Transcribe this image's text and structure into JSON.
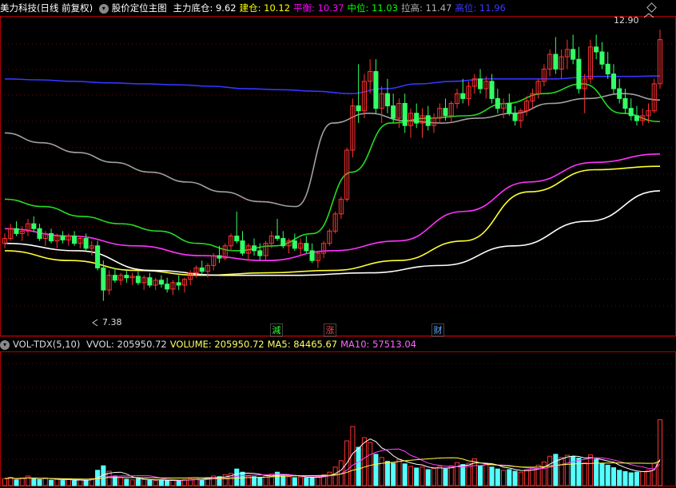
{
  "main_header": {
    "stock_name": "美力科技(日线 前复权)",
    "indicator_name": "股价定位主图",
    "items": [
      {
        "label": "主力底仓:",
        "value": "9.62",
        "color": "#ffffff"
      },
      {
        "label": "建仓:",
        "value": "10.12",
        "color": "#ffff00"
      },
      {
        "label": "平衡:",
        "value": "10.37",
        "color": "#ff00ff"
      },
      {
        "label": "中位:",
        "value": "11.03",
        "color": "#00ff00"
      },
      {
        "label": "拉高:",
        "value": "11.47",
        "color": "#b0b0b0"
      },
      {
        "label": "高位:",
        "value": "11.96",
        "color": "#3b3bff"
      }
    ]
  },
  "vol_header": {
    "indicator_name": "VOL-TDX(5,10)",
    "items": [
      {
        "label": "VVOL:",
        "value": "205950.72",
        "color": "#dddddd"
      },
      {
        "label": "VOLUME:",
        "value": "205950.72",
        "color": "#ffff66"
      },
      {
        "label": "MA5:",
        "value": "84465.67",
        "color": "#ffff66"
      },
      {
        "label": "MA10:",
        "value": "57513.04",
        "color": "#ff66ff"
      }
    ]
  },
  "annotations": {
    "high_label": "12.90",
    "low_label": "7.38"
  },
  "markers": [
    {
      "char": "減",
      "color": "#33ff33"
    },
    {
      "char": "涨",
      "color": "#ff4444"
    },
    {
      "char": "财",
      "color": "#66aaff"
    }
  ],
  "colors": {
    "up": "#ff3333",
    "down": "#33ff66",
    "vol_down": "#54ffff",
    "grid": "#7a0000",
    "border": "#b00000"
  },
  "chart_data": {
    "type": "candlestick",
    "price_range": [
      7.0,
      13.1
    ],
    "candles": [
      [
        8.55,
        8.75,
        8.45,
        8.65
      ],
      [
        8.65,
        8.95,
        8.6,
        8.85
      ],
      [
        8.85,
        9.0,
        8.7,
        8.75
      ],
      [
        8.75,
        8.9,
        8.6,
        8.8
      ],
      [
        8.8,
        9.05,
        8.7,
        8.95
      ],
      [
        8.95,
        9.1,
        8.8,
        8.85
      ],
      [
        8.85,
        8.95,
        8.6,
        8.65
      ],
      [
        8.65,
        8.8,
        8.5,
        8.75
      ],
      [
        8.75,
        8.85,
        8.55,
        8.6
      ],
      [
        8.6,
        8.75,
        8.45,
        8.7
      ],
      [
        8.7,
        8.8,
        8.55,
        8.62
      ],
      [
        8.62,
        8.75,
        8.5,
        8.7
      ],
      [
        8.7,
        8.8,
        8.5,
        8.55
      ],
      [
        8.55,
        8.7,
        8.45,
        8.65
      ],
      [
        8.65,
        8.75,
        8.4,
        8.45
      ],
      [
        8.45,
        8.6,
        8.3,
        8.5
      ],
      [
        8.5,
        8.6,
        8.0,
        8.05
      ],
      [
        8.05,
        8.2,
        7.38,
        7.6
      ],
      [
        7.6,
        8.0,
        7.5,
        7.9
      ],
      [
        7.9,
        8.05,
        7.75,
        7.8
      ],
      [
        7.8,
        7.95,
        7.7,
        7.9
      ],
      [
        7.9,
        8.0,
        7.75,
        7.85
      ],
      [
        7.85,
        7.95,
        7.7,
        7.88
      ],
      [
        7.88,
        7.98,
        7.7,
        7.75
      ],
      [
        7.75,
        7.9,
        7.6,
        7.85
      ],
      [
        7.85,
        7.95,
        7.65,
        7.7
      ],
      [
        7.7,
        7.85,
        7.6,
        7.8
      ],
      [
        7.8,
        7.9,
        7.65,
        7.72
      ],
      [
        7.72,
        7.85,
        7.55,
        7.62
      ],
      [
        7.62,
        7.8,
        7.5,
        7.75
      ],
      [
        7.75,
        7.9,
        7.6,
        7.7
      ],
      [
        7.7,
        7.85,
        7.55,
        7.82
      ],
      [
        7.82,
        8.0,
        7.7,
        7.95
      ],
      [
        7.95,
        8.1,
        7.85,
        8.05
      ],
      [
        8.05,
        8.2,
        7.9,
        7.98
      ],
      [
        7.98,
        8.15,
        7.85,
        8.1
      ],
      [
        8.1,
        8.35,
        8.0,
        8.3
      ],
      [
        8.3,
        8.5,
        8.15,
        8.25
      ],
      [
        8.25,
        8.55,
        8.2,
        8.5
      ],
      [
        8.5,
        8.75,
        8.4,
        8.7
      ],
      [
        8.7,
        9.2,
        8.55,
        8.6
      ],
      [
        8.6,
        8.8,
        8.3,
        8.35
      ],
      [
        8.35,
        8.55,
        8.2,
        8.5
      ],
      [
        8.5,
        8.65,
        8.3,
        8.4
      ],
      [
        8.4,
        8.55,
        8.2,
        8.3
      ],
      [
        8.3,
        8.6,
        8.2,
        8.55
      ],
      [
        8.55,
        8.8,
        8.45,
        8.7
      ],
      [
        8.7,
        9.05,
        8.6,
        8.65
      ],
      [
        8.65,
        8.8,
        8.45,
        8.5
      ],
      [
        8.5,
        8.65,
        8.35,
        8.6
      ],
      [
        8.6,
        8.75,
        8.4,
        8.45
      ],
      [
        8.45,
        8.65,
        8.3,
        8.55
      ],
      [
        8.55,
        8.7,
        8.35,
        8.4
      ],
      [
        8.4,
        8.55,
        8.15,
        8.2
      ],
      [
        8.2,
        8.4,
        8.05,
        8.35
      ],
      [
        8.35,
        8.6,
        8.25,
        8.55
      ],
      [
        8.55,
        8.85,
        8.5,
        8.8
      ],
      [
        8.8,
        9.2,
        8.75,
        9.15
      ],
      [
        9.15,
        9.5,
        9.05,
        9.45
      ],
      [
        9.45,
        10.5,
        9.4,
        10.45
      ],
      [
        10.45,
        11.5,
        10.3,
        11.35
      ],
      [
        11.35,
        12.2,
        11.0,
        11.25
      ],
      [
        11.25,
        12.0,
        11.1,
        11.85
      ],
      [
        11.85,
        12.3,
        11.6,
        12.05
      ],
      [
        12.05,
        12.3,
        11.2,
        11.3
      ],
      [
        11.3,
        11.75,
        11.0,
        11.6
      ],
      [
        11.6,
        11.9,
        11.2,
        11.35
      ],
      [
        11.35,
        11.6,
        11.0,
        11.1
      ],
      [
        11.1,
        11.5,
        10.9,
        11.4
      ],
      [
        11.4,
        11.6,
        10.8,
        10.95
      ],
      [
        10.95,
        11.3,
        10.7,
        11.2
      ],
      [
        11.2,
        11.4,
        10.9,
        11.0
      ],
      [
        11.0,
        11.3,
        10.7,
        11.15
      ],
      [
        11.15,
        11.35,
        10.85,
        10.95
      ],
      [
        10.95,
        11.2,
        10.8,
        11.1
      ],
      [
        11.1,
        11.4,
        11.0,
        11.3
      ],
      [
        11.3,
        11.5,
        11.05,
        11.15
      ],
      [
        11.15,
        11.45,
        11.0,
        11.4
      ],
      [
        11.4,
        11.7,
        11.3,
        11.6
      ],
      [
        11.6,
        11.9,
        11.4,
        11.5
      ],
      [
        11.5,
        11.85,
        11.35,
        11.75
      ],
      [
        11.75,
        12.0,
        11.6,
        11.9
      ],
      [
        11.9,
        12.1,
        11.6,
        11.7
      ],
      [
        11.7,
        11.95,
        11.5,
        11.85
      ],
      [
        11.85,
        12.0,
        11.4,
        11.5
      ],
      [
        11.5,
        11.7,
        11.2,
        11.3
      ],
      [
        11.3,
        11.5,
        11.1,
        11.4
      ],
      [
        11.4,
        11.6,
        11.15,
        11.2
      ],
      [
        11.2,
        11.35,
        10.95,
        11.05
      ],
      [
        11.05,
        11.3,
        10.9,
        11.25
      ],
      [
        11.25,
        11.55,
        11.15,
        11.45
      ],
      [
        11.45,
        11.7,
        11.3,
        11.6
      ],
      [
        11.6,
        11.9,
        11.5,
        11.85
      ],
      [
        11.85,
        12.2,
        11.75,
        12.1
      ],
      [
        12.1,
        12.5,
        11.95,
        12.4
      ],
      [
        12.4,
        12.75,
        12.0,
        12.1
      ],
      [
        12.1,
        12.5,
        11.9,
        12.35
      ],
      [
        12.35,
        12.7,
        12.1,
        12.5
      ],
      [
        12.5,
        12.8,
        12.2,
        12.3
      ],
      [
        12.3,
        12.55,
        11.6,
        11.7
      ],
      [
        11.7,
        12.0,
        11.2,
        11.9
      ],
      [
        11.9,
        12.7,
        11.8,
        12.55
      ],
      [
        12.55,
        12.8,
        12.3,
        12.45
      ],
      [
        12.45,
        12.65,
        12.1,
        12.2
      ],
      [
        12.2,
        12.45,
        11.9,
        12.0
      ],
      [
        12.0,
        12.2,
        11.6,
        11.7
      ],
      [
        11.7,
        11.9,
        11.4,
        11.5
      ],
      [
        11.5,
        11.7,
        11.2,
        11.3
      ],
      [
        11.3,
        11.5,
        11.05,
        11.15
      ],
      [
        11.15,
        11.35,
        10.95,
        11.05
      ],
      [
        11.05,
        11.3,
        10.95,
        11.15
      ],
      [
        11.15,
        11.4,
        11.0,
        11.25
      ],
      [
        11.25,
        11.9,
        11.2,
        11.8
      ],
      [
        11.8,
        12.9,
        11.7,
        12.7
      ]
    ],
    "volume_range": [
      0,
      410000
    ],
    "volumes": [
      22000,
      26000,
      18000,
      24000,
      30000,
      21000,
      19000,
      23000,
      17000,
      20000,
      16000,
      19000,
      15000,
      18000,
      17000,
      22000,
      48000,
      62000,
      45000,
      30000,
      25000,
      20000,
      18000,
      21000,
      19000,
      17000,
      16000,
      18000,
      15000,
      17000,
      16000,
      19000,
      22000,
      25000,
      20000,
      24000,
      30000,
      28000,
      34000,
      38000,
      52000,
      42000,
      30000,
      28000,
      26000,
      32000,
      36000,
      42000,
      30000,
      28000,
      25000,
      27000,
      24000,
      26000,
      28000,
      34000,
      42000,
      58000,
      78000,
      140000,
      185000,
      120000,
      150000,
      135000,
      98000,
      88000,
      76000,
      70000,
      82000,
      68000,
      60000,
      55000,
      58000,
      50000,
      54000,
      60000,
      52000,
      62000,
      72000,
      66000,
      70000,
      84000,
      62000,
      68000,
      58000,
      52000,
      48000,
      50000,
      45000,
      42000,
      50000,
      56000,
      64000,
      74000,
      92000,
      98000,
      88000,
      95000,
      90000,
      86000,
      72000,
      96000,
      82000,
      70000,
      64000,
      56000,
      48000,
      44000,
      40000,
      42000,
      44000,
      48000,
      70000,
      205950
    ],
    "ma_lines": {
      "high": {
        "color": "#3535ff",
        "values": [
          11.9,
          11.88,
          11.85,
          11.82,
          11.8,
          11.78,
          11.75,
          11.7,
          11.68,
          11.65,
          11.6,
          11.7,
          11.8,
          11.85,
          11.9,
          11.9,
          11.9,
          11.95,
          11.95,
          11.96
        ]
      },
      "lift": {
        "color": "#a0a0a0",
        "values": [
          10.8,
          10.6,
          10.4,
          10.2,
          10.0,
          9.8,
          9.6,
          9.4,
          9.3,
          11.0,
          11.2,
          11.05,
          11.0,
          11.1,
          11.2,
          11.4,
          11.5,
          11.6,
          11.47
        ]
      },
      "mid": {
        "color": "#22dd22",
        "values": [
          9.45,
          9.3,
          9.1,
          8.95,
          8.8,
          8.55,
          8.4,
          8.5,
          8.75,
          10.0,
          11.0,
          11.1,
          11.15,
          11.4,
          11.6,
          11.8,
          11.2,
          11.03
        ]
      },
      "balance": {
        "color": "#ff33ff",
        "values": [
          8.85,
          8.7,
          8.5,
          8.3,
          8.2,
          8.4,
          8.6,
          9.2,
          9.8,
          10.2,
          10.37
        ]
      },
      "build": {
        "color": "#ffff33",
        "values": [
          8.4,
          8.2,
          8.0,
          7.9,
          7.95,
          8.0,
          8.2,
          8.6,
          9.6,
          10.05,
          10.12
        ]
      },
      "base": {
        "color": "#ffffff",
        "values": [
          8.55,
          8.4,
          8.0,
          7.9,
          7.9,
          7.95,
          8.1,
          8.5,
          9.0,
          9.62
        ]
      }
    }
  }
}
